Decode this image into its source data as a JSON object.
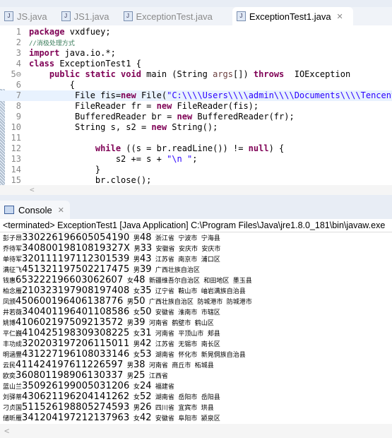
{
  "tabs": [
    {
      "label": "JS.java"
    },
    {
      "label": "JS1.java"
    },
    {
      "label": "ExceptionTest.java"
    },
    {
      "label": "ExceptionTest1.java",
      "active": true
    }
  ],
  "code": [
    {
      "n": "1",
      "html": "<span class=kw>package</span> vxdfuey;"
    },
    {
      "n": "2",
      "html": "<span class=cm>//消极处理方式</span>"
    },
    {
      "n": "3",
      "html": "<span class=kw>import</span> java.io.*;"
    },
    {
      "n": "4",
      "html": "<span class=kw>class</span> ExceptionTest1 {"
    },
    {
      "n": "5⊖",
      "html": "    <span class=kw>public static void</span> main (String <span style='color:#6a3e3e'>args</span>[]) <span class=kw>throws</span>  IOException"
    },
    {
      "n": "6",
      "html": "        {"
    },
    {
      "n": "7",
      "html": "         File fis=<span class=kw>new</span> File(<span class=st>\"C:\\\\\\\\Users\\\\\\\\admin\\\\\\\\Documents\\\\\\\\Tencent Fi</span>",
      "cur": true
    },
    {
      "n": "8",
      "html": "         FileReader fr = <span class=kw>new</span> FileReader(fis);"
    },
    {
      "n": "9",
      "html": "         BufferedReader br = <span class=kw>new</span> BufferedReader(fr);"
    },
    {
      "n": "10",
      "html": "         String s, s2 = <span class=kw>new</span> String();"
    },
    {
      "n": "11",
      "html": ""
    },
    {
      "n": "12",
      "html": "             <span class=kw>while</span> ((s = br.readLine()) != <span class=kw>null</span>) {"
    },
    {
      "n": "13",
      "html": "                 s2 += s + <span class=st>\"\\n \"</span>;"
    },
    {
      "n": "14",
      "html": "             }"
    },
    {
      "n": "15",
      "html": "             br.close();"
    }
  ],
  "console": {
    "tab_label": "Console",
    "status": "<terminated> ExceptionTest1 [Java Application] C:\\Program Files\\Java\\jre1.8.0_181\\bin\\javaw.exe",
    "rows": [
      [
        "彭子昂",
        "330226196605054190",
        "男",
        "48",
        "浙江省 宁波市 宁海县"
      ],
      [
        "乔待军",
        "34080019810819327X",
        "男",
        "33",
        "安徽省 安庆市 安庆市"
      ],
      [
        "单待军",
        "320111197112301539",
        "男",
        "43",
        "江苏省 南京市 浦口区"
      ],
      [
        "满征飞",
        "451321197502217475",
        "男",
        "39",
        "广西壮族自治区"
      ],
      [
        "钱惠",
        "653222196603062607",
        "女",
        "48",
        "新疆维吾尔自治区 和田地区 墨玉县"
      ],
      [
        "柏念雁",
        "210323197908197408",
        "女",
        "35",
        "辽宁省 鞍山市 岫岩满族自治县"
      ],
      [
        "凤颁",
        "450600196406138776",
        "男",
        "50",
        "广西壮族自治区 防城港市 防城港市"
      ],
      [
        "井若薇",
        "340401196401108586",
        "女",
        "50",
        "安徽省 淮南市 市辖区"
      ],
      [
        "姚博",
        "410602197509213572",
        "男",
        "39",
        "河南省 鹤壁市 鹤山区"
      ],
      [
        "平仁巍",
        "410425198309308225",
        "女",
        "31",
        "河南省 平顶山市 郏县"
      ],
      [
        "丰功成",
        "320203197206115011",
        "男",
        "42",
        "江苏省 无锡市 南长区"
      ],
      [
        "明涵豐",
        "431227196108033146",
        "女",
        "53",
        "湖南省 怀化市 新晃侗族自治县"
      ],
      [
        "云民",
        "411424197611226597",
        "男",
        "38",
        "河南省 商丘市 柘城县"
      ],
      [
        "欧奕",
        "360801198906130337",
        "男",
        "25",
        "江西省"
      ],
      [
        "蓝山兰",
        "350926199005031206",
        "女",
        "24",
        "福建省"
      ],
      [
        "刘驿蒂",
        "430621196204141262",
        "女",
        "52",
        "湖南省 岳阳市 岳阳县"
      ],
      [
        "刁贞国",
        "511526198805274593",
        "男",
        "26",
        "四川省 宜宾市 珙县"
      ],
      [
        "储昕雁",
        "341204197212137963",
        "女",
        "42",
        "安徽省 阜阳市 颍泉区"
      ]
    ]
  }
}
